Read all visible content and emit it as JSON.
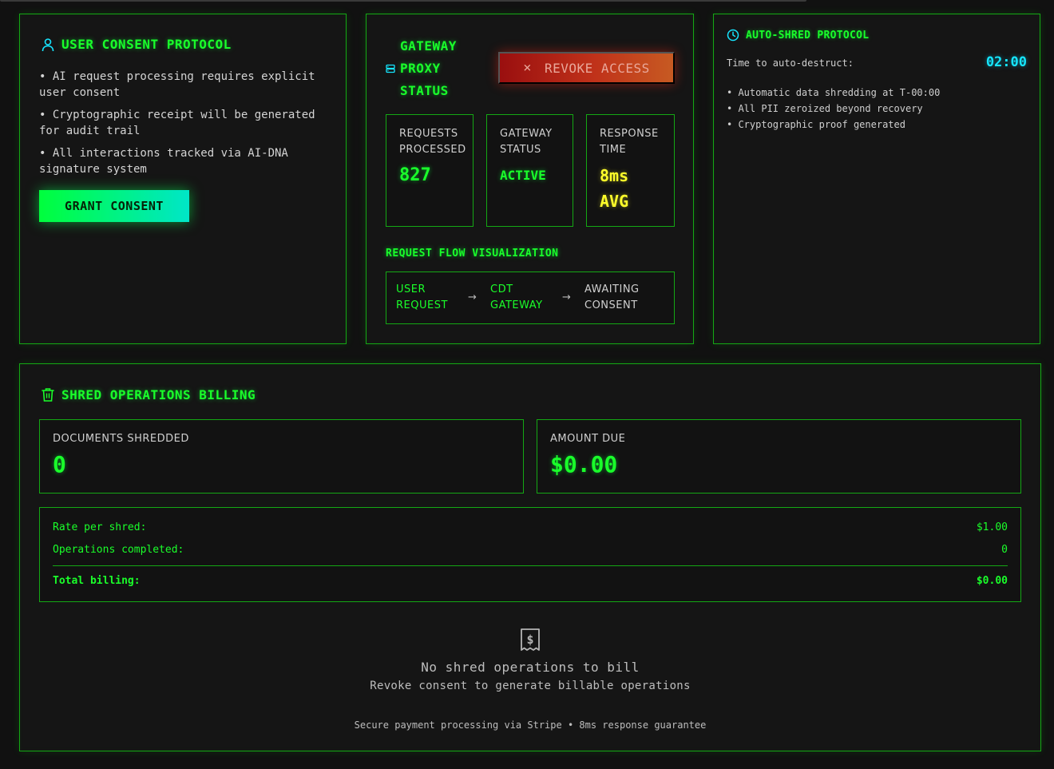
{
  "consent": {
    "title": "USER CONSENT PROTOCOL",
    "bullets": [
      "• AI request processing requires explicit user consent",
      "• Cryptographic receipt will be generated for audit trail",
      "• All interactions tracked via AI-DNA signature system"
    ],
    "grant_label": "GRANT CONSENT"
  },
  "gateway": {
    "title_lines": [
      "GATEWAY",
      "PROXY",
      "STATUS"
    ],
    "revoke_label": "REVOKE ACCESS",
    "stats": [
      {
        "label_lines": [
          "REQUESTS",
          "PROCESSED"
        ],
        "value": "827"
      },
      {
        "label_lines": [
          "GATEWAY",
          "STATUS"
        ],
        "value": "ACTIVE"
      },
      {
        "label_lines": [
          "RESPONSE",
          "TIME"
        ],
        "value_lines": [
          "8ms",
          "AVG"
        ]
      }
    ],
    "flow_title": "REQUEST FLOW VISUALIZATION",
    "flow_steps": [
      {
        "lines": [
          "USER",
          "REQUEST"
        ]
      },
      {
        "lines": [
          "CDT",
          "GATEWAY"
        ]
      },
      {
        "lines": [
          "AWAITING",
          "CONSENT"
        ]
      }
    ]
  },
  "autoshred": {
    "title": "AUTO-SHRED PROTOCOL",
    "countdown_label": "Time to auto-destruct:",
    "countdown_value": "02:00",
    "items": [
      "• Automatic data shredding at T-00:00",
      "• All PII zeroized beyond recovery",
      "• Cryptographic proof generated"
    ]
  },
  "billing": {
    "title": "SHRED OPERATIONS BILLING",
    "documents_label": "DOCUMENTS SHREDDED",
    "documents_value": "0",
    "amount_label": "AMOUNT DUE",
    "amount_value": "$0.00",
    "rate_label": "Rate per shred:",
    "rate_value": "$1.00",
    "ops_label": "Operations completed:",
    "ops_value": "0",
    "total_label": "Total billing:",
    "total_value": "$0.00",
    "empty_title": "No shred operations to bill",
    "empty_subtitle": "Revoke consent to generate billable operations",
    "footer": "Secure payment processing via Stripe • 8ms response guarantee"
  },
  "colors": {
    "accent": "#1aff2a",
    "border": "#14a814",
    "timer": "#16e6ff",
    "response": "#ffff2a",
    "danger": "#b32114"
  }
}
